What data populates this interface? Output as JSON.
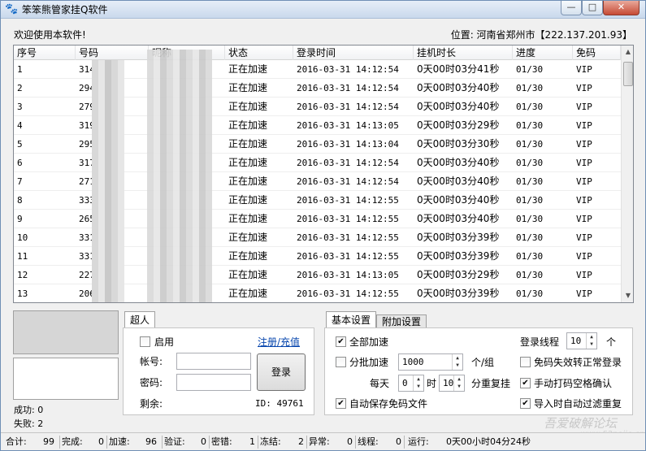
{
  "window": {
    "title": "笨笨熊管家挂Q软件",
    "min": "—",
    "max": "□",
    "close": "✕"
  },
  "header": {
    "welcome": "欢迎使用本软件!",
    "location": "位置: 河南省郑州市【222.137.201.93】"
  },
  "table": {
    "columns": [
      "序号",
      "号码",
      "昵称",
      "状态",
      "登录时间",
      "挂机时长",
      "进度",
      "免码"
    ],
    "rows": [
      [
        "1",
        "3144",
        "",
        "正在加速",
        "2016-03-31 14:12:54",
        "0天00时03分41秒",
        "01/30",
        "VIP"
      ],
      [
        "2",
        "2940",
        "",
        "正在加速",
        "2016-03-31 14:12:54",
        "0天00时03分40秒",
        "01/30",
        "VIP"
      ],
      [
        "3",
        "2795",
        "",
        "正在加速",
        "2016-03-31 14:12:54",
        "0天00时03分40秒",
        "01/30",
        "VIP"
      ],
      [
        "4",
        "3199",
        "",
        "正在加速",
        "2016-03-31 14:13:05",
        "0天00时03分29秒",
        "01/30",
        "VIP"
      ],
      [
        "5",
        "2956",
        "",
        "正在加速",
        "2016-03-31 14:13:04",
        "0天00时03分30秒",
        "01/30",
        "VIP"
      ],
      [
        "6",
        "3172",
        "",
        "正在加速",
        "2016-03-31 14:12:54",
        "0天00时03分40秒",
        "01/30",
        "VIP"
      ],
      [
        "7",
        "2714",
        "",
        "正在加速",
        "2016-03-31 14:12:54",
        "0天00时03分40秒",
        "01/30",
        "VIP"
      ],
      [
        "8",
        "3332",
        "",
        "正在加速",
        "2016-03-31 14:12:55",
        "0天00时03分40秒",
        "01/30",
        "VIP"
      ],
      [
        "9",
        "2655",
        "",
        "正在加速",
        "2016-03-31 14:12:55",
        "0天00时03分40秒",
        "01/30",
        "VIP"
      ],
      [
        "10",
        "3314",
        "",
        "正在加速",
        "2016-03-31 14:12:55",
        "0天00时03分39秒",
        "01/30",
        "VIP"
      ],
      [
        "11",
        "3314",
        "",
        "正在加速",
        "2016-03-31 14:12:55",
        "0天00时03分39秒",
        "01/30",
        "VIP"
      ],
      [
        "12",
        "2271",
        "",
        "正在加速",
        "2016-03-31 14:13:05",
        "0天00时03分29秒",
        "01/30",
        "VIP"
      ],
      [
        "13",
        "2067",
        "",
        "正在加速",
        "2016-03-31 14:12:55",
        "0天00时03分39秒",
        "01/30",
        "VIP"
      ]
    ]
  },
  "stats": {
    "success": "成功: 0",
    "fail": "失败: 2"
  },
  "login_panel": {
    "tab": "超人",
    "enable_label": "启用",
    "register_link": "注册/充值",
    "account_label": "帐号:",
    "password_label": "密码:",
    "remaining_label": "剩余:",
    "id_text": "ID: 49761",
    "login_button": "登录",
    "account_value": "",
    "password_value": ""
  },
  "settings": {
    "tabs": [
      "基本设置",
      "附加设置"
    ],
    "all_speedup": "全部加速",
    "batch_speedup": "分批加速",
    "batch_value": "1000",
    "per_group": "个/组",
    "daily": "每天",
    "hour_value": "0",
    "hour_label": "时",
    "minute_value": "10",
    "minute_label": "分重复挂",
    "auto_save": "自动保存免码文件",
    "login_threads_label": "登录线程",
    "login_threads_value": "10",
    "threads_unit": "个",
    "fallback_login": "免码失效转正常登录",
    "manual_captcha": "手动打码空格确认",
    "auto_filter": "导入时自动过滤重复",
    "checks": {
      "all_speedup": true,
      "batch_speedup": false,
      "auto_save": true,
      "fallback_login": false,
      "manual_captcha": true,
      "auto_filter": true,
      "enable": false
    }
  },
  "statusbar": {
    "total": "合计:",
    "total_v": "99",
    "done": "完成:",
    "done_v": "0",
    "speed": "加速:",
    "speed_v": "96",
    "verify": "验证:",
    "verify_v": "0",
    "pwderr": "密错:",
    "pwderr_v": "1",
    "frozen": "冻结:",
    "frozen_v": "2",
    "abnormal": "异常:",
    "abnormal_v": "0",
    "threads": "线程:",
    "threads_v": "0",
    "running": "运行:",
    "running_v": "0天00小时04分24秒"
  },
  "watermark": {
    "text": "吾爱破解论坛",
    "url": "www.52pojie.cn"
  }
}
